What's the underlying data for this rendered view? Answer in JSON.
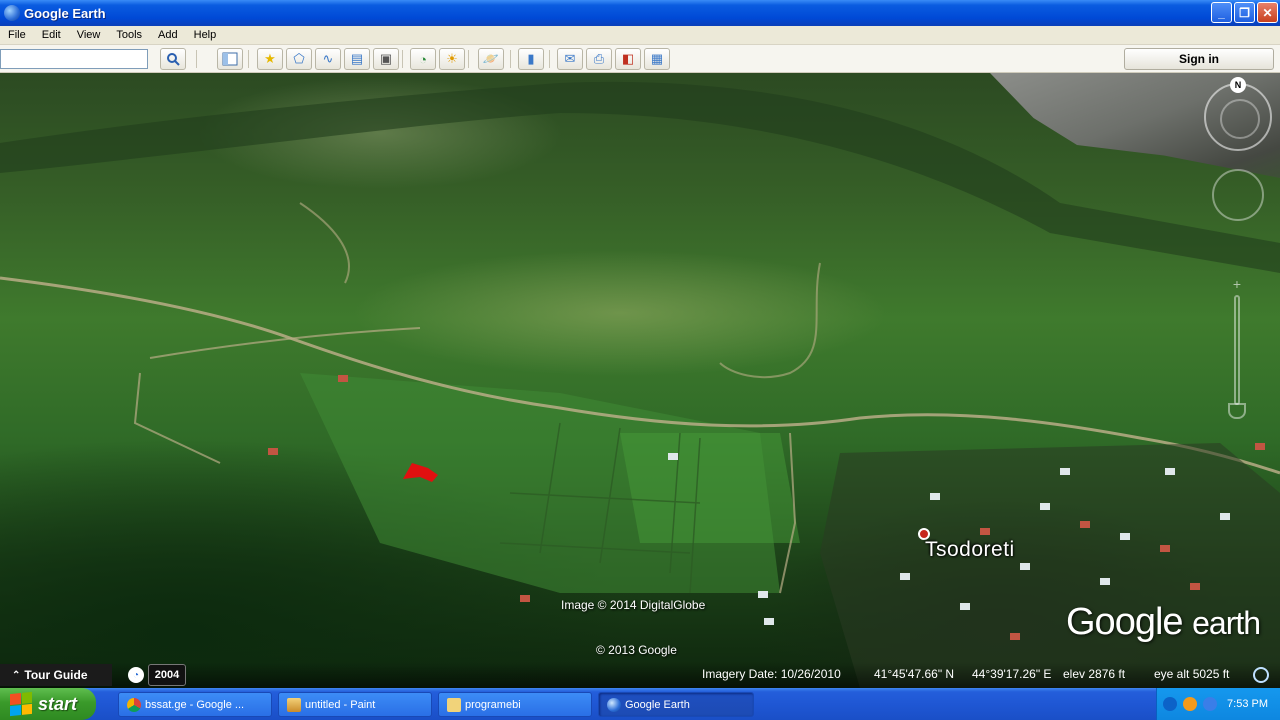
{
  "window": {
    "title": "Google Earth"
  },
  "menu": [
    "File",
    "Edit",
    "View",
    "Tools",
    "Add",
    "Help"
  ],
  "toolbar": {
    "search_value": "",
    "sign_in": "Sign in"
  },
  "map": {
    "place_label": "Tsodoreti",
    "credit_imagery": "Image © 2014 DigitalGlobe",
    "credit_map": "© 2013 Google",
    "logo_main": "Google",
    "logo_sub": "earth"
  },
  "nav": {
    "north": "N",
    "zoom_plus": "+"
  },
  "status": {
    "tour_guide": "Tour Guide",
    "year": "2004",
    "imagery_date": "Imagery Date: 10/26/2010",
    "lat": "41°45'47.66\" N",
    "lon": "44°39'17.26\" E",
    "elev": "elev  2876 ft",
    "eye_alt": "eye alt   5025 ft"
  },
  "taskbar": {
    "start": "start",
    "tasks": [
      {
        "label": "bssat.ge - Google ...",
        "icon": "chrome-icon"
      },
      {
        "label": "untitled - Paint",
        "icon": "paint-icon"
      },
      {
        "label": "programebi",
        "icon": "folder-icon"
      },
      {
        "label": "Google Earth",
        "icon": "google-earth-icon"
      }
    ],
    "clock": "7:53 PM"
  },
  "colors": {
    "titlebar": "#0049d6",
    "taskbar": "#245edb",
    "start_button": "#3a9a2a",
    "marker": "#e01010"
  }
}
